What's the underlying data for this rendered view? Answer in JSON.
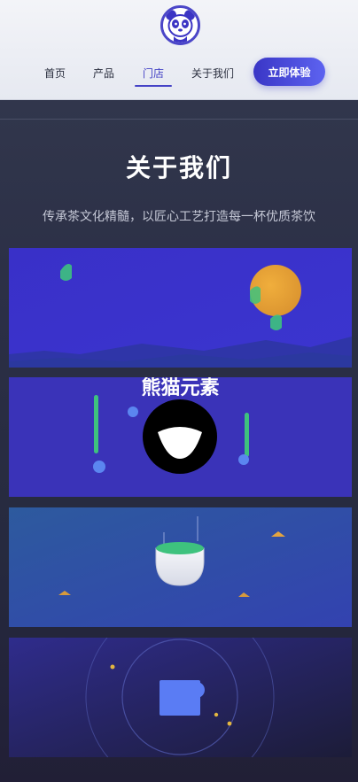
{
  "brand": {
    "logo_icon": "panda-logo-icon"
  },
  "nav": {
    "items": [
      {
        "label": "首页",
        "active": false
      },
      {
        "label": "产品",
        "active": false
      },
      {
        "label": "门店",
        "active": true
      },
      {
        "label": "关于我们",
        "active": false
      }
    ],
    "cta_label": "立即体验"
  },
  "section": {
    "title": "关于我们",
    "subtitle": "传承茶文化精髓，以匠心工艺打造每一杯优质茶饮"
  },
  "cards": [
    {
      "illustration": "landscape-moon-illustration"
    },
    {
      "illustration": "panda-element-illustration",
      "caption": "熊猫元素"
    },
    {
      "illustration": "tea-bowl-illustration"
    },
    {
      "illustration": "orbit-square-illustration"
    }
  ],
  "colors": {
    "accent": "#4543c6",
    "card_blue": "#3a33c9",
    "moon": "#e9a23a",
    "leaf_green": "#3ec27e",
    "dot_blue": "#5b86f0"
  }
}
